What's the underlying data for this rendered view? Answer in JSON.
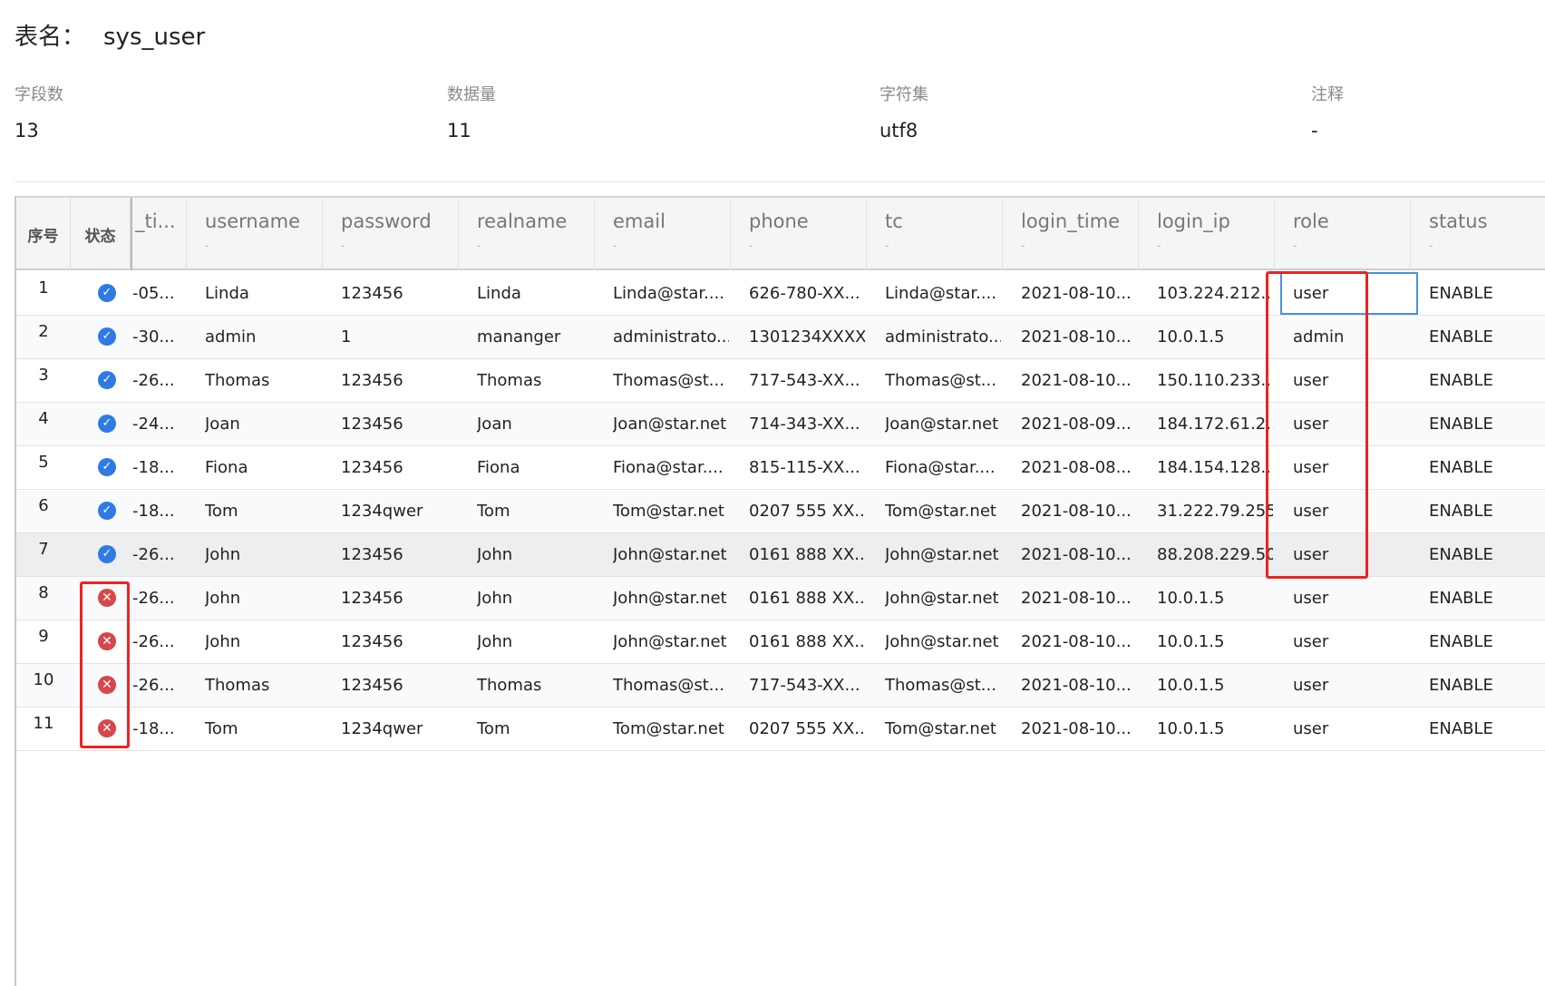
{
  "table": {
    "label": "表名：",
    "name": "sys_user"
  },
  "stats": [
    {
      "label": "字段数",
      "value": "13"
    },
    {
      "label": "数据量",
      "value": "11"
    },
    {
      "label": "字符集",
      "value": "utf8"
    },
    {
      "label": "注释",
      "value": "-"
    }
  ],
  "grid": {
    "fixed_headers": {
      "index": "序号",
      "state": "状态"
    },
    "columns": [
      {
        "name": "_ti...",
        "sub": ""
      },
      {
        "name": "username",
        "sub": "-"
      },
      {
        "name": "password",
        "sub": "-"
      },
      {
        "name": "realname",
        "sub": "-"
      },
      {
        "name": "email",
        "sub": "-"
      },
      {
        "name": "phone",
        "sub": "-"
      },
      {
        "name": "tc",
        "sub": "-"
      },
      {
        "name": "login_time",
        "sub": "-"
      },
      {
        "name": "login_ip",
        "sub": "-"
      },
      {
        "name": "role",
        "sub": "-"
      },
      {
        "name": "status",
        "sub": "-"
      }
    ],
    "rows": [
      {
        "idx": "1",
        "state": "ok",
        "cells": [
          "-05...",
          "Linda",
          "123456",
          "Linda",
          "Linda@star....",
          "626-780-XX...",
          "Linda@star....",
          "2021-08-10...",
          "103.224.212....",
          "user",
          "ENABLE"
        ]
      },
      {
        "idx": "2",
        "state": "ok",
        "cells": [
          "-30...",
          "admin",
          "1",
          "mananger",
          "administrato...",
          "1301234XXXX",
          "administrato...",
          "2021-08-10...",
          "10.0.1.5",
          "admin",
          "ENABLE"
        ]
      },
      {
        "idx": "3",
        "state": "ok",
        "cells": [
          "-26...",
          "Thomas",
          "123456",
          "Thomas",
          "Thomas@st...",
          "717-543-XX...",
          "Thomas@st...",
          "2021-08-10...",
          "150.110.233....",
          "user",
          "ENABLE"
        ]
      },
      {
        "idx": "4",
        "state": "ok",
        "cells": [
          "-24...",
          "Joan",
          "123456",
          "Joan",
          "Joan@star.net",
          "714-343-XX...",
          "Joan@star.net",
          "2021-08-09...",
          "184.172.61.2...",
          "user",
          "ENABLE"
        ]
      },
      {
        "idx": "5",
        "state": "ok",
        "cells": [
          "-18...",
          "Fiona",
          "123456",
          "Fiona",
          "Fiona@star....",
          "815-115-XX...",
          "Fiona@star....",
          "2021-08-08...",
          "184.154.128....",
          "user",
          "ENABLE"
        ]
      },
      {
        "idx": "6",
        "state": "ok",
        "cells": [
          "-18...",
          "Tom",
          "1234qwer",
          "Tom",
          "Tom@star.net",
          "0207 555 XX...",
          "Tom@star.net",
          "2021-08-10...",
          "31.222.79.255",
          "user",
          "ENABLE"
        ]
      },
      {
        "idx": "7",
        "state": "ok",
        "cells": [
          "-26...",
          "John",
          "123456",
          "John",
          "John@star.net",
          "0161 888 XX...",
          "John@star.net",
          "2021-08-10...",
          "88.208.229.50",
          "user",
          "ENABLE"
        ]
      },
      {
        "idx": "8",
        "state": "bad",
        "cells": [
          "-26...",
          "John",
          "123456",
          "John",
          "John@star.net",
          "0161 888 XX...",
          "John@star.net",
          "2021-08-10...",
          "10.0.1.5",
          "user",
          "ENABLE"
        ]
      },
      {
        "idx": "9",
        "state": "bad",
        "cells": [
          "-26...",
          "John",
          "123456",
          "John",
          "John@star.net",
          "0161 888 XX...",
          "John@star.net",
          "2021-08-10...",
          "10.0.1.5",
          "user",
          "ENABLE"
        ]
      },
      {
        "idx": "10",
        "state": "bad",
        "cells": [
          "-26...",
          "Thomas",
          "123456",
          "Thomas",
          "Thomas@st...",
          "717-543-XX...",
          "Thomas@st...",
          "2021-08-10...",
          "10.0.1.5",
          "user",
          "ENABLE"
        ]
      },
      {
        "idx": "11",
        "state": "bad",
        "cells": [
          "-18...",
          "Tom",
          "1234qwer",
          "Tom",
          "Tom@star.net",
          "0207 555 XX...",
          "Tom@star.net",
          "2021-08-10...",
          "10.0.1.5",
          "user",
          "ENABLE"
        ]
      }
    ],
    "selected": {
      "row": 1,
      "column": "role"
    },
    "highlighted_row": 7
  },
  "icons": {
    "ok": "check-circle-icon",
    "bad": "x-circle-icon"
  },
  "colors": {
    "ok": "#2f7ae5",
    "bad": "#d6474b",
    "annotation": "#ee2222",
    "selection": "#4a90e2"
  }
}
